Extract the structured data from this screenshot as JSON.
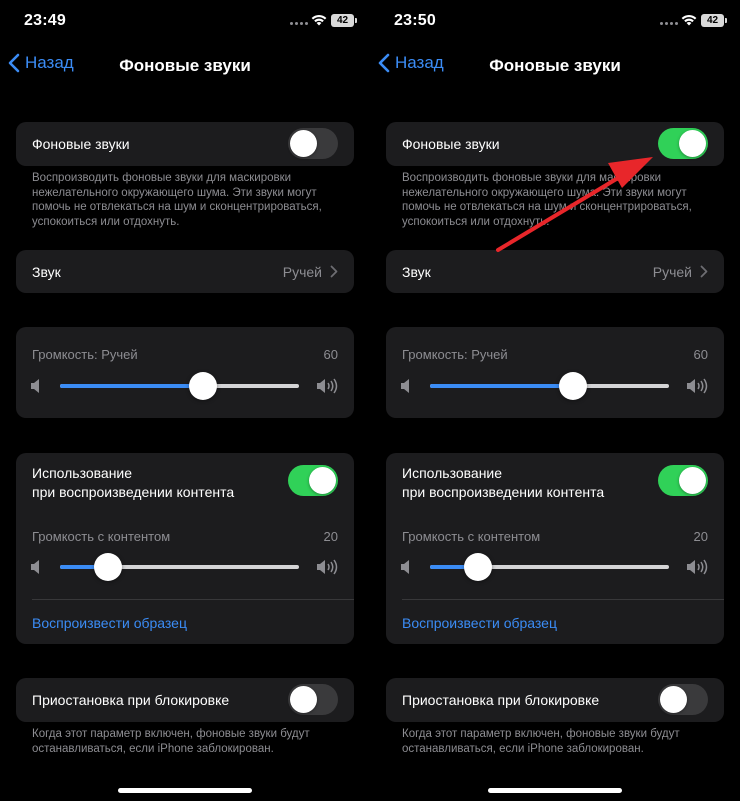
{
  "screens": [
    {
      "status": {
        "time": "23:49",
        "battery": "42"
      },
      "nav": {
        "back": "Назад",
        "title": "Фоновые звуки"
      },
      "background_sounds": {
        "label": "Фоновые звуки",
        "enabled": false,
        "footnote": "Воспроизводить фоновые звуки для маскировки нежелательного окружающего шума. Эти звуки могут помочь не отвлекаться на шум и сконцентрироваться, успокоиться или отдохнуть."
      },
      "sound": {
        "label": "Звук",
        "value": "Ручей"
      },
      "volume": {
        "caption": "Громкость: Ручей",
        "value": "60",
        "level": 0.6
      },
      "media": {
        "label_line1": "Использование",
        "label_line2": "при воспроизведении контента",
        "enabled": true,
        "caption": "Громкость с контентом",
        "value": "20",
        "level": 0.2,
        "play_sample": "Воспроизвести образец"
      },
      "lock": {
        "label": "Приостановка при блокировке",
        "enabled": false,
        "footnote": "Когда этот параметр включен, фоновые звуки будут останавливаться, если iPhone заблокирован."
      }
    },
    {
      "status": {
        "time": "23:50",
        "battery": "42"
      },
      "nav": {
        "back": "Назад",
        "title": "Фоновые звуки"
      },
      "background_sounds": {
        "label": "Фоновые звуки",
        "enabled": true,
        "footnote": "Воспроизводить фоновые звуки для маскировки нежелательного окружающего шума. Эти звуки могут помочь не отвлекаться на шум и сконцентрироваться, успокоиться или отдохнуть."
      },
      "sound": {
        "label": "Звук",
        "value": "Ручей"
      },
      "volume": {
        "caption": "Громкость: Ручей",
        "value": "60",
        "level": 0.6
      },
      "media": {
        "label_line1": "Использование",
        "label_line2": "при воспроизведении контента",
        "enabled": true,
        "caption": "Громкость с контентом",
        "value": "20",
        "level": 0.2,
        "play_sample": "Воспроизвести образец"
      },
      "lock": {
        "label": "Приостановка при блокировке",
        "enabled": false,
        "footnote": "Когда этот параметр включен, фоновые звуки будут останавливаться, если iPhone заблокирован."
      }
    }
  ],
  "colors": {
    "accent": "#3b8cf5",
    "switch_on": "#30d158",
    "switch_off": "#3a3a3c",
    "annotation_arrow": "#e8262a"
  },
  "annotation": {
    "type": "arrow",
    "points_to": "background-sounds-switch",
    "screen": 2
  }
}
